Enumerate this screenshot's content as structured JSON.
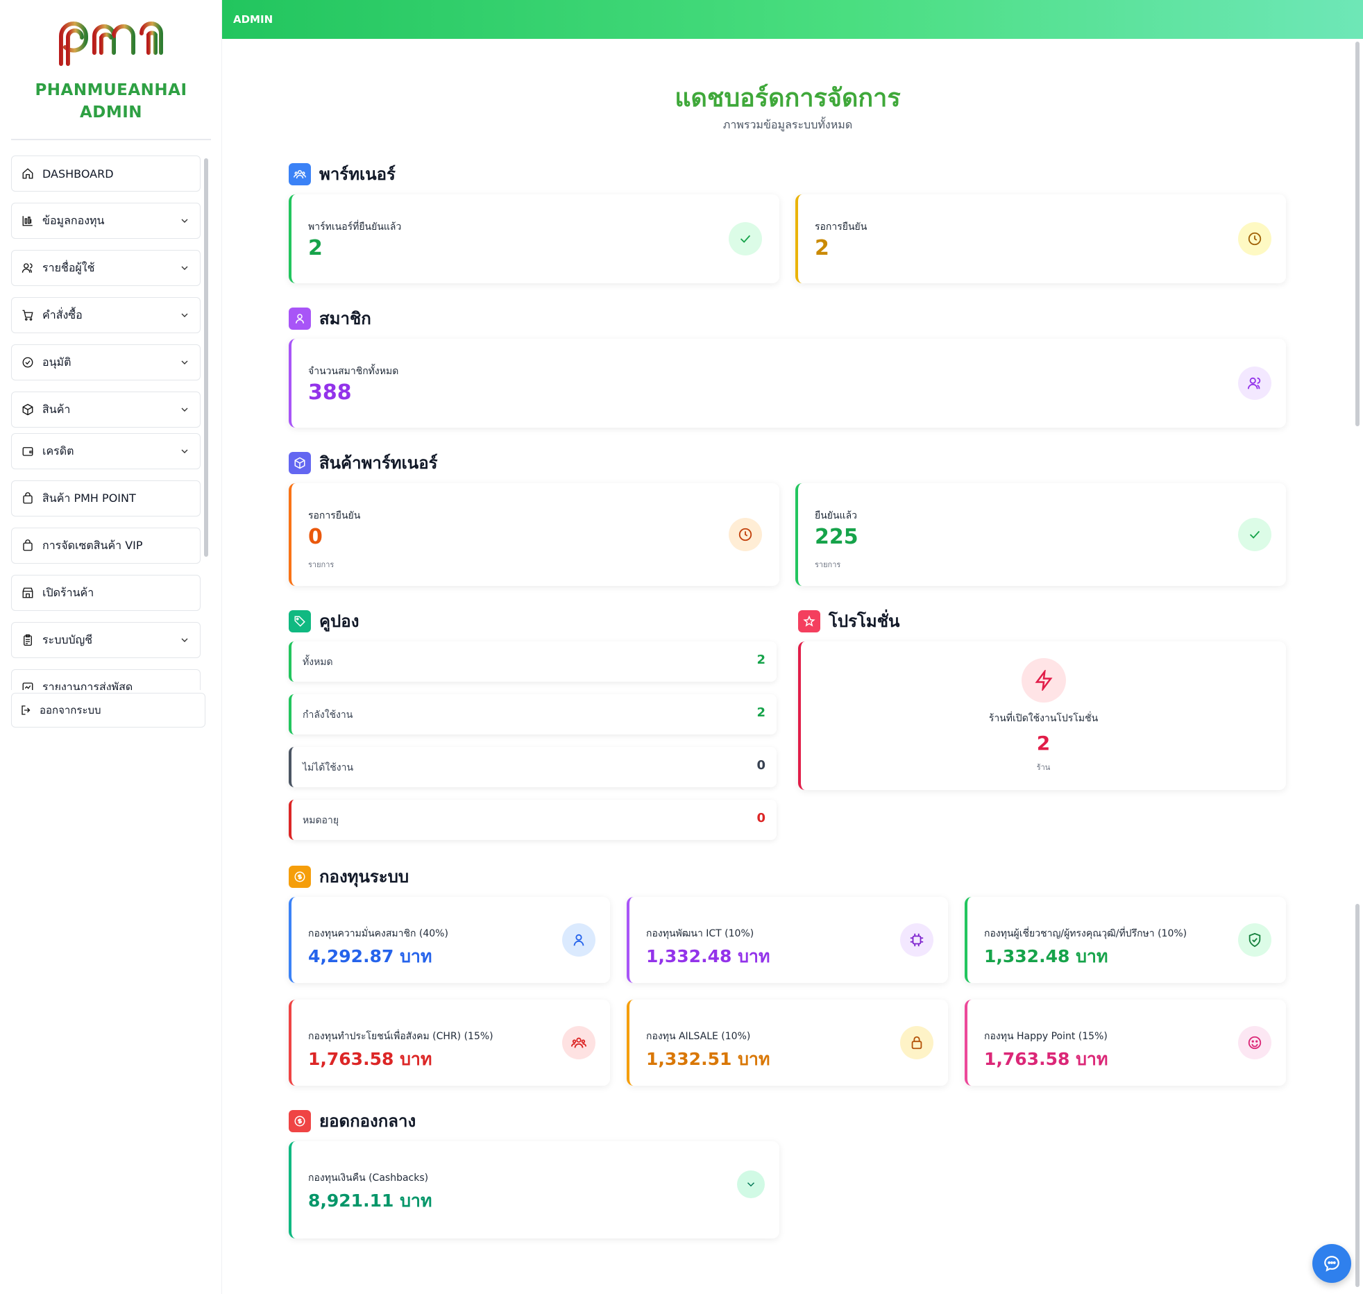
{
  "sidebar": {
    "logo_text": "pmh",
    "brand_line1": "PHANMUEANHAI",
    "brand_line2": "ADMIN",
    "items": [
      {
        "label": "DASHBOARD",
        "icon": "home-icon"
      },
      {
        "label": "ข้อมูลกองทุน",
        "icon": "chart-icon"
      },
      {
        "label": "รายชื่อผู้ใช้",
        "icon": "users-icon"
      },
      {
        "label": "คำสั่งซื้อ",
        "icon": "cart-icon"
      },
      {
        "label": "อนุมัติ",
        "icon": "check-circle-icon"
      },
      {
        "label": "สินค้า",
        "icon": "box-icon"
      },
      {
        "label": "เครดิต",
        "icon": "wallet-icon"
      },
      {
        "label": "สินค้า PMH POINT",
        "icon": "bag-icon"
      },
      {
        "label": "การจัดเซตสินค้า VIP",
        "icon": "bag-icon"
      },
      {
        "label": "เปิดร้านค้า",
        "icon": "store-icon"
      },
      {
        "label": "ระบบบัญชี",
        "icon": "clipboard-icon"
      },
      {
        "label": "รายงานการส่งพัสดุ",
        "icon": "report-icon"
      }
    ],
    "logout": "ออกจากระบบ"
  },
  "topbar": {
    "title": "ADMIN"
  },
  "header": {
    "title": "แดชบอร์ดการจัดการ",
    "subtitle": "ภาพรวมข้อมูลระบบทั้งหมด"
  },
  "partners": {
    "title": "พาร์ทเนอร์",
    "confirmed_label": "พาร์ทเนอร์ที่ยืนยันแล้ว",
    "confirmed_value": "2",
    "pending_label": "รอการยืนยัน",
    "pending_value": "2"
  },
  "members": {
    "title": "สมาชิก",
    "total_label": "จำนวนสมาชิกทั้งหมด",
    "total_value": "388"
  },
  "partner_products": {
    "title": "สินค้าพาร์ทเนอร์",
    "pending_label": "รอการยืนยัน",
    "pending_value": "0",
    "pending_unit": "รายการ",
    "confirmed_label": "ยืนยันแล้ว",
    "confirmed_value": "225",
    "confirmed_unit": "รายการ"
  },
  "coupons": {
    "title": "คูปอง",
    "rows": [
      {
        "label": "ทั้งหมด",
        "value": "2",
        "color": "#22c55e"
      },
      {
        "label": "กำลังใช้งาน",
        "value": "2",
        "color": "#22c55e"
      },
      {
        "label": "ไม่ได้ใช้งาน",
        "value": "0",
        "color": "#4b5563"
      },
      {
        "label": "หมดอายุ",
        "value": "0",
        "color": "#dc2626"
      }
    ]
  },
  "promotions": {
    "title": "โปรโมชั่น",
    "label": "ร้านที่เปิดใช้งานโปรโมชั่น",
    "value": "2",
    "unit": "ร้าน"
  },
  "funds": {
    "title": "กองทุนระบบ",
    "items": [
      {
        "label": "กองทุนความมั่นคงสมาชิก (40%)",
        "value": "4,292.87 บาท",
        "color": "#2563eb",
        "icon": "user-icon"
      },
      {
        "label": "กองทุนพัฒนา ICT (10%)",
        "value": "1,332.48 บาท",
        "color": "#9333ea",
        "icon": "chip-icon"
      },
      {
        "label": "กองทุนผู้เชี่ยวชาญ/ผู้ทรงคุณวุฒิ/ที่ปรึกษา (10%)",
        "value": "1,332.48 บาท",
        "color": "#16a34a",
        "icon": "shield-icon"
      },
      {
        "label": "กองทุนทำประโยชน์เพื่อสังคม (CHR) (15%)",
        "value": "1,763.58 บาท",
        "color": "#dc2626",
        "icon": "group-icon"
      },
      {
        "label": "กองทุน AILSALE (10%)",
        "value": "1,332.51 บาท",
        "color": "#d97706",
        "icon": "lock-icon"
      },
      {
        "label": "กองทุน Happy Point (15%)",
        "value": "1,763.58 บาท",
        "color": "#db2777",
        "icon": "smile-icon"
      }
    ]
  },
  "central": {
    "title": "ยอดกองกลาง",
    "label": "กองทุนเงินคืน (Cashbacks)",
    "value": "8,921.11 บาท"
  }
}
